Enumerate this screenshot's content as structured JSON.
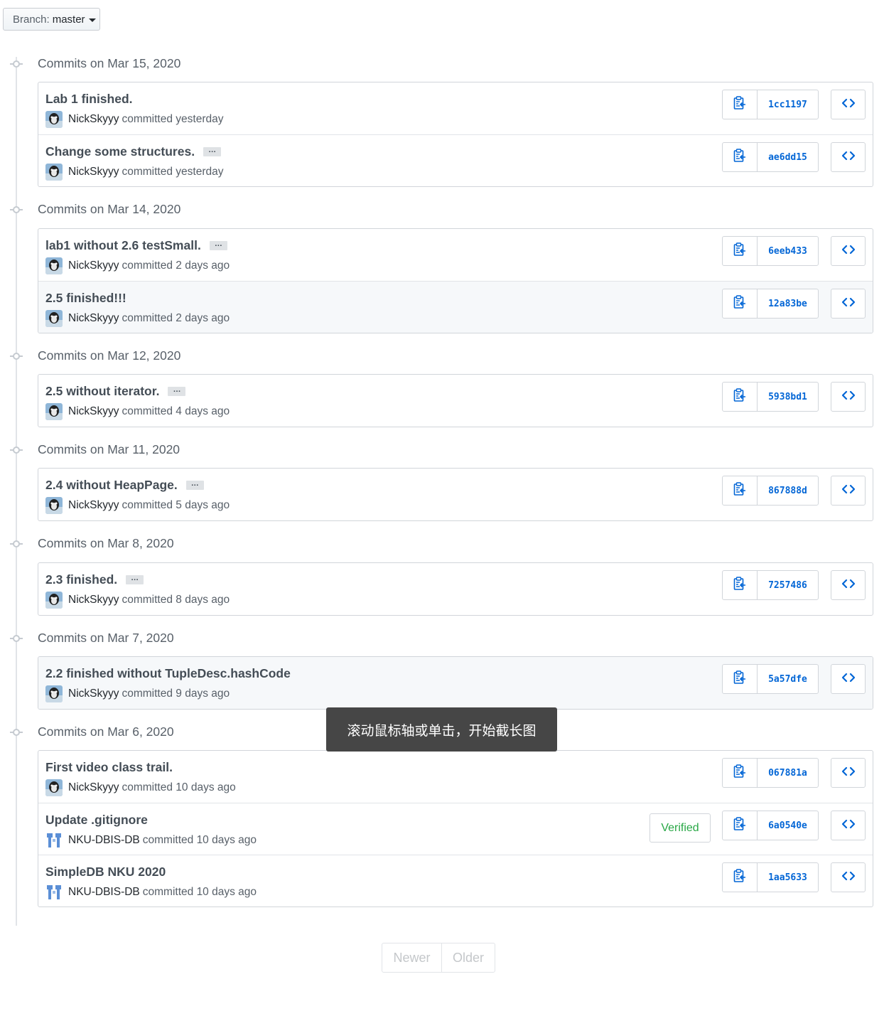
{
  "branch": {
    "label": "Branch:",
    "name": "master"
  },
  "groups": [
    {
      "title": "Commits on Mar 15, 2020",
      "commits": [
        {
          "message": "Lab 1 finished.",
          "ellipsis": false,
          "author": "NickSkyyy",
          "avatar": "user",
          "time": "committed yesterday",
          "sha": "1cc1197",
          "verified": false,
          "highlight": false
        },
        {
          "message": "Change some structures.",
          "ellipsis": true,
          "author": "NickSkyyy",
          "avatar": "user",
          "time": "committed yesterday",
          "sha": "ae6dd15",
          "verified": false,
          "highlight": false
        }
      ]
    },
    {
      "title": "Commits on Mar 14, 2020",
      "commits": [
        {
          "message": "lab1 without 2.6 testSmall.",
          "ellipsis": true,
          "author": "NickSkyyy",
          "avatar": "user",
          "time": "committed 2 days ago",
          "sha": "6eeb433",
          "verified": false,
          "highlight": false
        },
        {
          "message": "2.5 finished!!!",
          "ellipsis": false,
          "author": "NickSkyyy",
          "avatar": "user",
          "time": "committed 2 days ago",
          "sha": "12a83be",
          "verified": false,
          "highlight": true
        }
      ]
    },
    {
      "title": "Commits on Mar 12, 2020",
      "commits": [
        {
          "message": "2.5 without iterator.",
          "ellipsis": true,
          "author": "NickSkyyy",
          "avatar": "user",
          "time": "committed 4 days ago",
          "sha": "5938bd1",
          "verified": false,
          "highlight": false
        }
      ]
    },
    {
      "title": "Commits on Mar 11, 2020",
      "commits": [
        {
          "message": "2.4 without HeapPage.",
          "ellipsis": true,
          "author": "NickSkyyy",
          "avatar": "user",
          "time": "committed 5 days ago",
          "sha": "867888d",
          "verified": false,
          "highlight": false
        }
      ]
    },
    {
      "title": "Commits on Mar 8, 2020",
      "commits": [
        {
          "message": "2.3 finished.",
          "ellipsis": true,
          "author": "NickSkyyy",
          "avatar": "user",
          "time": "committed 8 days ago",
          "sha": "7257486",
          "verified": false,
          "highlight": false
        }
      ]
    },
    {
      "title": "Commits on Mar 7, 2020",
      "commits": [
        {
          "message": "2.2 finished without TupleDesc.hashCode",
          "ellipsis": false,
          "author": "NickSkyyy",
          "avatar": "user",
          "time": "committed 9 days ago",
          "sha": "5a57dfe",
          "verified": false,
          "highlight": true
        }
      ]
    },
    {
      "title": "Commits on Mar 6, 2020",
      "commits": [
        {
          "message": "First video class trail.",
          "ellipsis": false,
          "author": "NickSkyyy",
          "avatar": "user",
          "time": "committed 10 days ago",
          "sha": "067881a",
          "verified": false,
          "highlight": false
        },
        {
          "message": "Update .gitignore",
          "ellipsis": false,
          "author": "NKU-DBIS-DB",
          "avatar": "org",
          "time": "committed 10 days ago",
          "sha": "6a0540e",
          "verified": true,
          "highlight": false
        },
        {
          "message": "SimpleDB NKU 2020",
          "ellipsis": false,
          "author": "NKU-DBIS-DB",
          "avatar": "org",
          "time": "committed 10 days ago",
          "sha": "1aa5633",
          "verified": false,
          "highlight": false
        }
      ]
    }
  ],
  "verified_label": "Verified",
  "ellipsis_label": "…",
  "pagination": {
    "newer": "Newer",
    "older": "Older"
  },
  "tooltip": "滚动鼠标轴或单击，开始截长图",
  "colors": {
    "link": "#0366d6",
    "verified": "#28a745",
    "border": "#d1d5da",
    "highlight": "#f6f8fa"
  },
  "icons": {
    "clipboard": "clipboard-icon",
    "browse": "code-icon",
    "node": "commit-node-icon"
  }
}
